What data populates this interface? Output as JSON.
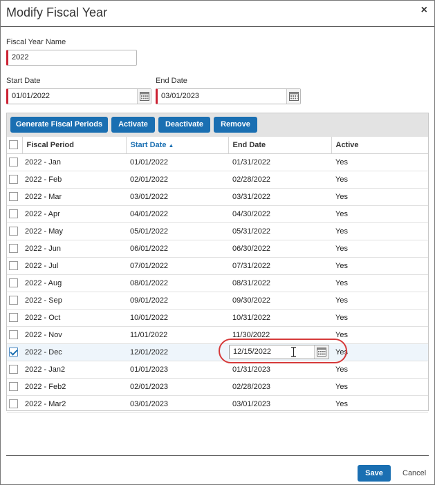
{
  "dialog": {
    "title": "Modify Fiscal Year",
    "close_symbol": "×"
  },
  "form": {
    "fiscal_year_name_label": "Fiscal Year Name",
    "fiscal_year_name_value": "2022",
    "start_date_label": "Start Date",
    "start_date_value": "01/01/2022",
    "end_date_label": "End Date",
    "end_date_value": "03/01/2023"
  },
  "toolbar": {
    "generate_label": "Generate Fiscal Periods",
    "activate_label": "Activate",
    "deactivate_label": "Deactivate",
    "remove_label": "Remove"
  },
  "table": {
    "columns": [
      "Fiscal Period",
      "Start Date",
      "End Date",
      "Active"
    ],
    "sorted_column": "Start Date",
    "sort_direction_symbol": "▲",
    "rows": [
      {
        "period": "2022 - Jan",
        "start": "01/01/2022",
        "end": "01/31/2022",
        "active": "Yes",
        "checked": false
      },
      {
        "period": "2022 - Feb",
        "start": "02/01/2022",
        "end": "02/28/2022",
        "active": "Yes",
        "checked": false
      },
      {
        "period": "2022 - Mar",
        "start": "03/01/2022",
        "end": "03/31/2022",
        "active": "Yes",
        "checked": false
      },
      {
        "period": "2022 - Apr",
        "start": "04/01/2022",
        "end": "04/30/2022",
        "active": "Yes",
        "checked": false
      },
      {
        "period": "2022 - May",
        "start": "05/01/2022",
        "end": "05/31/2022",
        "active": "Yes",
        "checked": false
      },
      {
        "period": "2022 - Jun",
        "start": "06/01/2022",
        "end": "06/30/2022",
        "active": "Yes",
        "checked": false
      },
      {
        "period": "2022 - Jul",
        "start": "07/01/2022",
        "end": "07/31/2022",
        "active": "Yes",
        "checked": false
      },
      {
        "period": "2022 - Aug",
        "start": "08/01/2022",
        "end": "08/31/2022",
        "active": "Yes",
        "checked": false
      },
      {
        "period": "2022 - Sep",
        "start": "09/01/2022",
        "end": "09/30/2022",
        "active": "Yes",
        "checked": false
      },
      {
        "period": "2022 - Oct",
        "start": "10/01/2022",
        "end": "10/31/2022",
        "active": "Yes",
        "checked": false
      },
      {
        "period": "2022 - Nov",
        "start": "11/01/2022",
        "end": "11/30/2022",
        "active": "Yes",
        "checked": false
      },
      {
        "period": "2022 - Dec",
        "start": "12/01/2022",
        "end": "12/15/2022",
        "active": "Yes",
        "checked": true,
        "editing": true
      },
      {
        "period": "2022 - Jan2",
        "start": "01/01/2023",
        "end": "01/31/2023",
        "active": "Yes",
        "checked": false
      },
      {
        "period": "2022 - Feb2",
        "start": "02/01/2023",
        "end": "02/28/2023",
        "active": "Yes",
        "checked": false
      },
      {
        "period": "2022 - Mar2",
        "start": "03/01/2023",
        "end": "03/01/2023",
        "active": "Yes",
        "checked": false
      }
    ]
  },
  "footer": {
    "save_label": "Save",
    "cancel_label": "Cancel"
  },
  "colors": {
    "primary_button": "#1a6fb2",
    "required_marker": "#cc2233",
    "highlight_ring": "#d63a3a"
  },
  "icons": [
    "close-icon",
    "calendar-icon",
    "text-cursor-icon",
    "sort-ascending-icon",
    "checkbox-icon"
  ]
}
